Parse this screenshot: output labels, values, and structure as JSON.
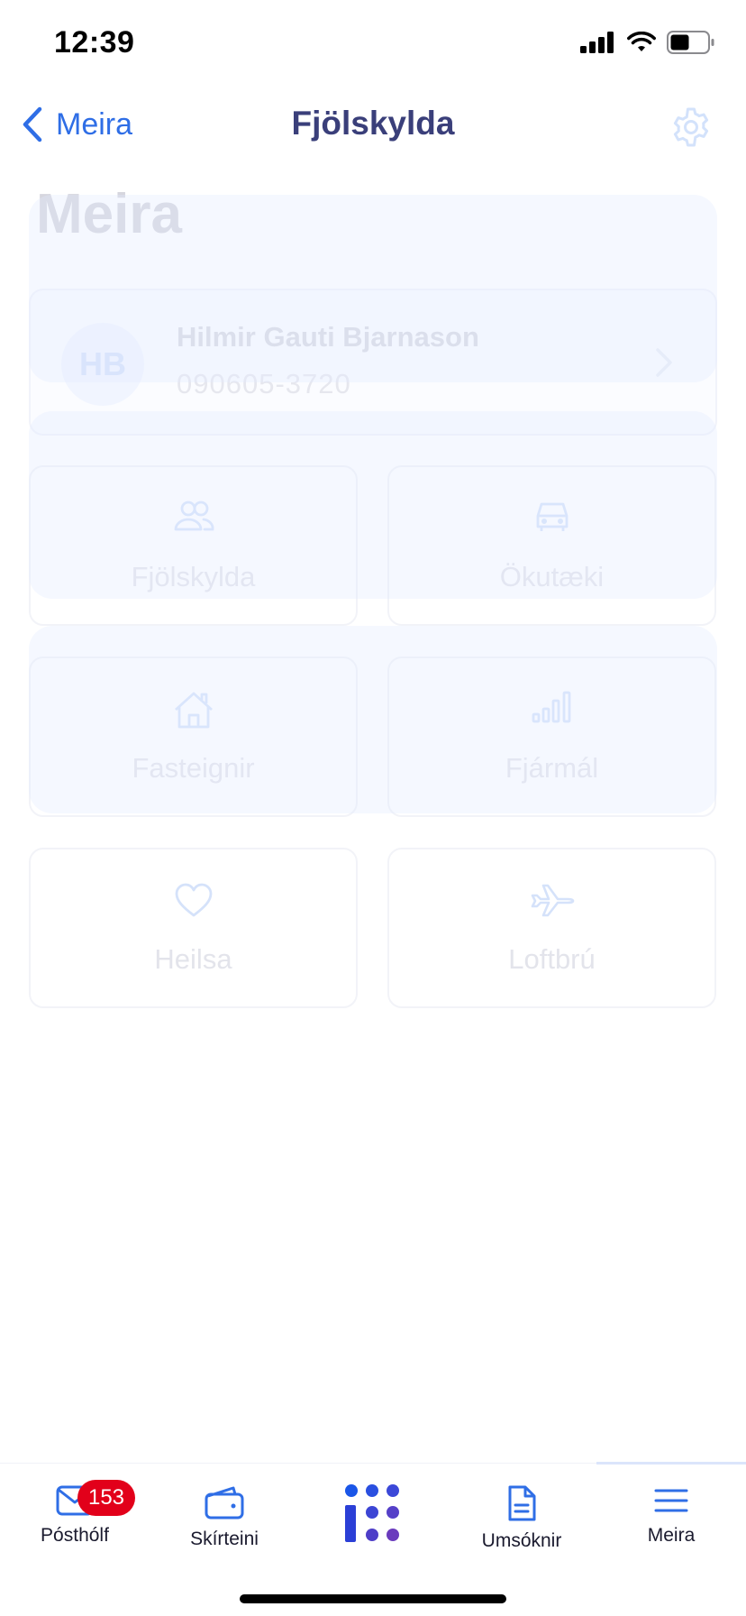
{
  "status_bar": {
    "time": "12:39"
  },
  "nav": {
    "back_label": "Meira",
    "title": "Fjölskylda"
  },
  "underlay": {
    "title": "Meira",
    "user": {
      "initials": "HB",
      "name": "Hilmir Gauti Bjarnason",
      "kennitala": "090605-3720"
    },
    "tiles": [
      {
        "label": "Fjölskylda",
        "icon": "people-icon"
      },
      {
        "label": "Ökutæki",
        "icon": "car-icon"
      },
      {
        "label": "Fasteignir",
        "icon": "house-icon"
      },
      {
        "label": "Fjármál",
        "icon": "signal-bars-icon"
      },
      {
        "label": "Heilsa",
        "icon": "heart-icon"
      },
      {
        "label": "Loftbrú",
        "icon": "airplane-icon"
      }
    ]
  },
  "tab_bar": {
    "tabs": [
      {
        "label": "Pósthólf",
        "icon": "envelope-icon",
        "badge": "153"
      },
      {
        "label": "Skírteini",
        "icon": "wallet-icon"
      },
      {
        "label": "",
        "icon": "island-logo-icon"
      },
      {
        "label": "Umsóknir",
        "icon": "document-icon"
      },
      {
        "label": "Meira",
        "icon": "menu-icon"
      }
    ]
  },
  "colors": {
    "accent_blue": "#2f6ee6",
    "title_navy": "#3a3f7a",
    "badge_red": "#e2001a"
  }
}
